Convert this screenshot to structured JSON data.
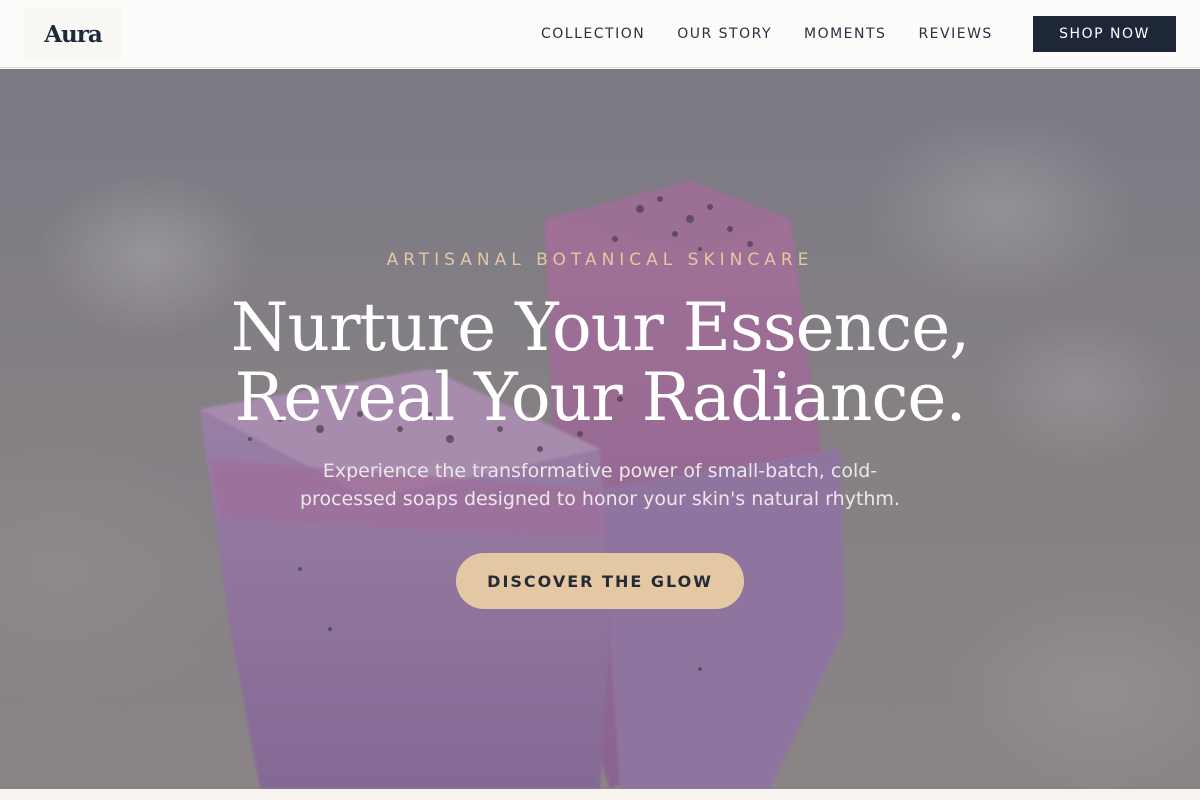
{
  "header": {
    "logo": "Aura",
    "nav": [
      {
        "label": "COLLECTION"
      },
      {
        "label": "OUR STORY"
      },
      {
        "label": "MOMENTS"
      },
      {
        "label": "REVIEWS"
      }
    ],
    "cta_label": "SHOP NOW"
  },
  "hero": {
    "eyebrow": "ARTISANAL BOTANICAL SKINCARE",
    "headline_line1": "Nurture Your Essence,",
    "headline_line2": "Reveal Your Radiance.",
    "subtext_line1": "Experience the transformative power of small-batch, cold-",
    "subtext_line2": "processed soaps designed to honor your skin's natural rhythm.",
    "cta_label": "DISCOVER THE GLOW"
  },
  "colors": {
    "brand_dark": "#1e2738",
    "accent_sand": "#e3c8a3",
    "eyebrow_gold": "#e5c7a3",
    "soap_lilac": "#b58cc4"
  }
}
